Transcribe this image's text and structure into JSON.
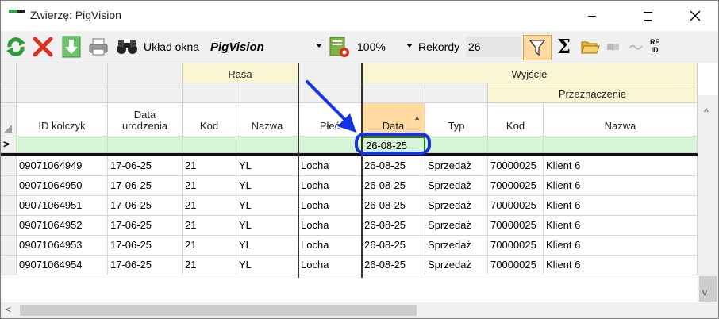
{
  "window": {
    "title": "Zwierzę: PigVision"
  },
  "toolbar": {
    "layout_label": "Układ okna",
    "layout_value": "PigVision",
    "zoom_value": "100%",
    "records_label": "Rekordy",
    "records_value": "26",
    "sigma": "Σ",
    "rfid_top": "RF",
    "rfid_bottom": "ID",
    "icons": [
      "refresh-icon",
      "delete-icon",
      "download-icon",
      "print-icon",
      "binoculars-icon",
      "report-settings-icon",
      "filter-icon",
      "sum-icon",
      "open-folder-icon",
      "tag-icon",
      "rfid-scan-icon"
    ]
  },
  "grid": {
    "groups": {
      "rasa": "Rasa",
      "wyjscie": "Wyjście",
      "przeznaczenie": "Przeznaczenie"
    },
    "columns": {
      "id": "ID kolczyk",
      "birth_line1": "Data",
      "birth_line2": "urodzenia",
      "breed_code": "Kod",
      "breed_name": "Nazwa",
      "sex": "Płeć",
      "exit_date": "Data",
      "exit_type": "Typ",
      "dest_code": "Kod",
      "dest_name": "Nazwa"
    },
    "sort_indicator": "▲",
    "row_pointer": ">",
    "filter_value": "26-08-25",
    "rows": [
      [
        "09071064949",
        "17-06-25",
        "21",
        "YL",
        "Locha",
        "26-08-25",
        "Sprzedaż",
        "70000025",
        "Klient 6"
      ],
      [
        "09071064950",
        "17-06-25",
        "21",
        "YL",
        "Locha",
        "26-08-25",
        "Sprzedaż",
        "70000025",
        "Klient 6"
      ],
      [
        "09071064951",
        "17-06-25",
        "21",
        "YL",
        "Locha",
        "26-08-25",
        "Sprzedaż",
        "70000025",
        "Klient 6"
      ],
      [
        "09071064952",
        "17-06-25",
        "21",
        "YL",
        "Locha",
        "26-08-25",
        "Sprzedaż",
        "70000025",
        "Klient 6"
      ],
      [
        "09071064953",
        "17-06-25",
        "21",
        "YL",
        "Locha",
        "26-08-25",
        "Sprzedaż",
        "70000025",
        "Klient 6"
      ],
      [
        "09071064954",
        "17-06-25",
        "21",
        "YL",
        "Locha",
        "26-08-25",
        "Sprzedaż",
        "70000025",
        "Klient 6"
      ]
    ]
  },
  "colors": {
    "accent_filter": "#ffd9a0",
    "filter_row": "#d6f5d6",
    "group_header": "#fbf6d2",
    "annotation": "#1433e6"
  }
}
